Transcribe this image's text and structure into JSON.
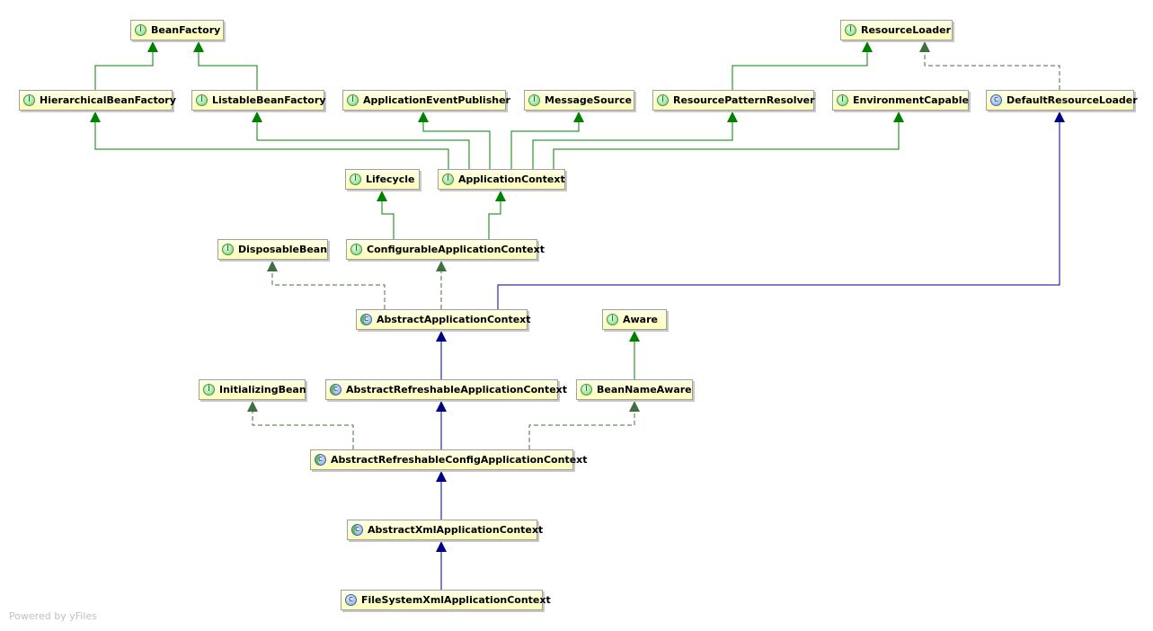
{
  "colors": {
    "interface_edge": "#008000",
    "class_edge": "#000080",
    "realization_edge": "#407040",
    "node_fill": "#ffffc0",
    "node_border": "#a0a0a0"
  },
  "nodes": [
    {
      "name": "BeanFactory",
      "kind": "interface",
      "icon": "I"
    },
    {
      "name": "ResourceLoader",
      "kind": "interface",
      "icon": "I"
    },
    {
      "name": "HierarchicalBeanFactory",
      "kind": "interface",
      "icon": "I"
    },
    {
      "name": "ListableBeanFactory",
      "kind": "interface",
      "icon": "I"
    },
    {
      "name": "ApplicationEventPublisher",
      "kind": "interface",
      "icon": "I"
    },
    {
      "name": "MessageSource",
      "kind": "interface",
      "icon": "I"
    },
    {
      "name": "ResourcePatternResolver",
      "kind": "interface",
      "icon": "I"
    },
    {
      "name": "EnvironmentCapable",
      "kind": "interface",
      "icon": "I"
    },
    {
      "name": "DefaultResourceLoader",
      "kind": "class",
      "icon": "c"
    },
    {
      "name": "Lifecycle",
      "kind": "interface",
      "icon": "I"
    },
    {
      "name": "ApplicationContext",
      "kind": "interface",
      "icon": "I"
    },
    {
      "name": "DisposableBean",
      "kind": "interface",
      "icon": "I"
    },
    {
      "name": "ConfigurableApplicationContext",
      "kind": "interface",
      "icon": "I"
    },
    {
      "name": "AbstractApplicationContext",
      "kind": "abstract",
      "icon": "c"
    },
    {
      "name": "Aware",
      "kind": "interface",
      "icon": "I"
    },
    {
      "name": "InitializingBean",
      "kind": "interface",
      "icon": "I"
    },
    {
      "name": "AbstractRefreshableApplicationContext",
      "kind": "abstract",
      "icon": "c"
    },
    {
      "name": "BeanNameAware",
      "kind": "interface",
      "icon": "I"
    },
    {
      "name": "AbstractRefreshableConfigApplicationContext",
      "kind": "abstract",
      "icon": "c"
    },
    {
      "name": "AbstractXmlApplicationContext",
      "kind": "abstract",
      "icon": "c"
    },
    {
      "name": "FileSystemXmlApplicationContext",
      "kind": "class",
      "icon": "c"
    }
  ],
  "edges": [
    {
      "from": "HierarchicalBeanFactory",
      "to": "BeanFactory",
      "type": "interface-extends"
    },
    {
      "from": "ListableBeanFactory",
      "to": "BeanFactory",
      "type": "interface-extends"
    },
    {
      "from": "ApplicationContext",
      "to": "HierarchicalBeanFactory",
      "type": "interface-extends"
    },
    {
      "from": "ApplicationContext",
      "to": "ListableBeanFactory",
      "type": "interface-extends"
    },
    {
      "from": "ApplicationContext",
      "to": "ApplicationEventPublisher",
      "type": "interface-extends"
    },
    {
      "from": "ApplicationContext",
      "to": "MessageSource",
      "type": "interface-extends"
    },
    {
      "from": "ApplicationContext",
      "to": "ResourcePatternResolver",
      "type": "interface-extends"
    },
    {
      "from": "ApplicationContext",
      "to": "EnvironmentCapable",
      "type": "interface-extends"
    },
    {
      "from": "ResourcePatternResolver",
      "to": "ResourceLoader",
      "type": "interface-extends"
    },
    {
      "from": "DefaultResourceLoader",
      "to": "ResourceLoader",
      "type": "implements"
    },
    {
      "from": "ConfigurableApplicationContext",
      "to": "Lifecycle",
      "type": "interface-extends"
    },
    {
      "from": "ConfigurableApplicationContext",
      "to": "ApplicationContext",
      "type": "interface-extends"
    },
    {
      "from": "AbstractApplicationContext",
      "to": "DisposableBean",
      "type": "implements"
    },
    {
      "from": "AbstractApplicationContext",
      "to": "ConfigurableApplicationContext",
      "type": "implements"
    },
    {
      "from": "AbstractApplicationContext",
      "to": "DefaultResourceLoader",
      "type": "extends"
    },
    {
      "from": "AbstractRefreshableApplicationContext",
      "to": "AbstractApplicationContext",
      "type": "extends"
    },
    {
      "from": "BeanNameAware",
      "to": "Aware",
      "type": "interface-extends"
    },
    {
      "from": "AbstractRefreshableConfigApplicationContext",
      "to": "InitializingBean",
      "type": "implements"
    },
    {
      "from": "AbstractRefreshableConfigApplicationContext",
      "to": "AbstractRefreshableApplicationContext",
      "type": "extends"
    },
    {
      "from": "AbstractRefreshableConfigApplicationContext",
      "to": "BeanNameAware",
      "type": "implements"
    },
    {
      "from": "AbstractXmlApplicationContext",
      "to": "AbstractRefreshableConfigApplicationContext",
      "type": "extends"
    },
    {
      "from": "FileSystemXmlApplicationContext",
      "to": "AbstractXmlApplicationContext",
      "type": "extends"
    }
  ],
  "footer": "Powered by yFiles"
}
